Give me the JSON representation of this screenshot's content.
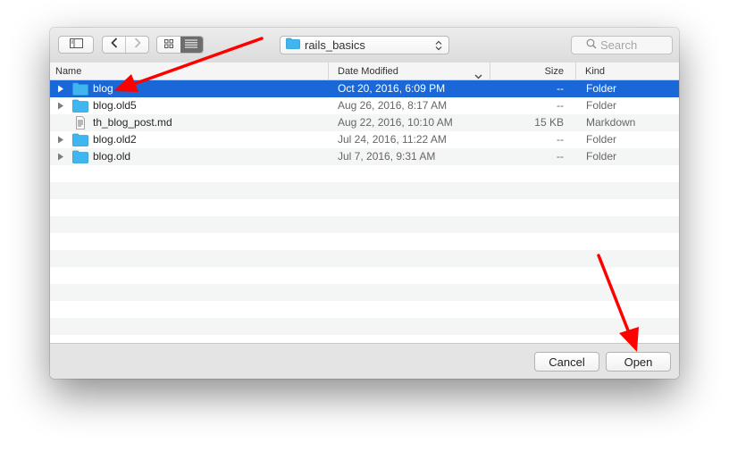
{
  "toolbar": {
    "location": "rails_basics",
    "search_placeholder": "Search",
    "icons": {
      "sidebar": "sidebar-toggle-icon",
      "back": "chevron-left-icon",
      "forward": "chevron-right-icon",
      "icon_view": "icon-grid-icon",
      "list_view": "list-view-icon",
      "location": "folder-icon",
      "popup": "updown-arrows-icon",
      "search": "magnifier-icon"
    }
  },
  "columns": {
    "name": "Name",
    "date": "Date Modified",
    "size": "Size",
    "kind": "Kind"
  },
  "files": [
    {
      "name": "blog",
      "date": "Oct 20, 2016, 6:09 PM",
      "size": "--",
      "kind": "Folder",
      "type": "folder",
      "selected": true
    },
    {
      "name": "blog.old5",
      "date": "Aug 26, 2016, 8:17 AM",
      "size": "--",
      "kind": "Folder",
      "type": "folder",
      "selected": false
    },
    {
      "name": "th_blog_post.md",
      "date": "Aug 22, 2016, 10:10 AM",
      "size": "15 KB",
      "kind": "Markdown",
      "type": "file",
      "selected": false
    },
    {
      "name": "blog.old2",
      "date": "Jul 24, 2016, 11:22 AM",
      "size": "--",
      "kind": "Folder",
      "type": "folder",
      "selected": false
    },
    {
      "name": "blog.old",
      "date": "Jul 7, 2016, 9:31 AM",
      "size": "--",
      "kind": "Folder",
      "type": "folder",
      "selected": false
    }
  ],
  "footer": {
    "cancel_label": "Cancel",
    "open_label": "Open"
  },
  "colors": {
    "selection": "#1a68d8",
    "folder": "#3fb6f0",
    "annotation_arrow": "#ff0000"
  }
}
